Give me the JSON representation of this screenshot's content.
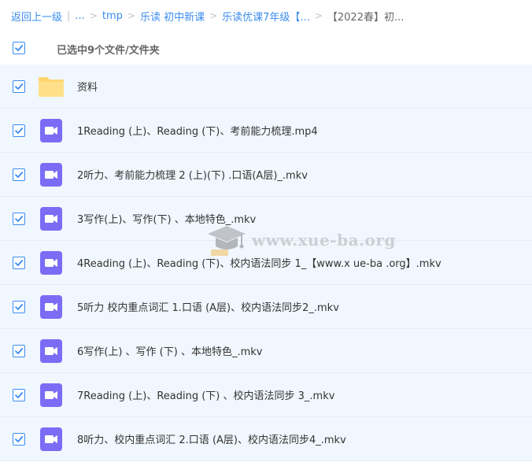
{
  "breadcrumb": {
    "back": "返回上一级",
    "ellipsis": "...",
    "items": [
      "tmp",
      "乐读 初中新课",
      "乐读优课7年级【..."
    ],
    "current": "【2022春】初..."
  },
  "header": {
    "selection_text": "已选中9个文件/文件夹"
  },
  "files": [
    {
      "name": "资料",
      "icon": "folder-icon"
    },
    {
      "name": "1Reading (上)、Reading (下)、考前能力梳理.mp4",
      "icon": "video-file-icon"
    },
    {
      "name": "2听力、考前能力梳理 2 (上)(下) .口语(A层)_.mkv",
      "icon": "video-file-icon"
    },
    {
      "name": "3写作(上)、写作(下) 、本地特色_.mkv",
      "icon": "video-file-icon"
    },
    {
      "name": "4Reading (上)、Reading (下)、校内语法同步 1_【www.x ue-ba .org】.mkv",
      "icon": "video-file-icon"
    },
    {
      "name": "5听力 校内重点词汇 1.口语 (A层)、校内语法同步2_.mkv",
      "icon": "video-file-icon"
    },
    {
      "name": "6写作(上) 、写作 (下) 、本地特色_.mkv",
      "icon": "video-file-icon"
    },
    {
      "name": "7Reading (上)、Reading (下) 、校内语法同步 3_.mkv",
      "icon": "video-file-icon"
    },
    {
      "name": "8听力、校内重点词汇 2.口语 (A层)、校内语法同步4_.mkv",
      "icon": "video-file-icon"
    }
  ],
  "watermark": {
    "text": "www.xue-ba.org"
  },
  "colors": {
    "accent": "#3b8cf0",
    "row_bg": "#f0f7fe",
    "video_icon": "#7b6cf6",
    "folder": "#ffd66e"
  }
}
